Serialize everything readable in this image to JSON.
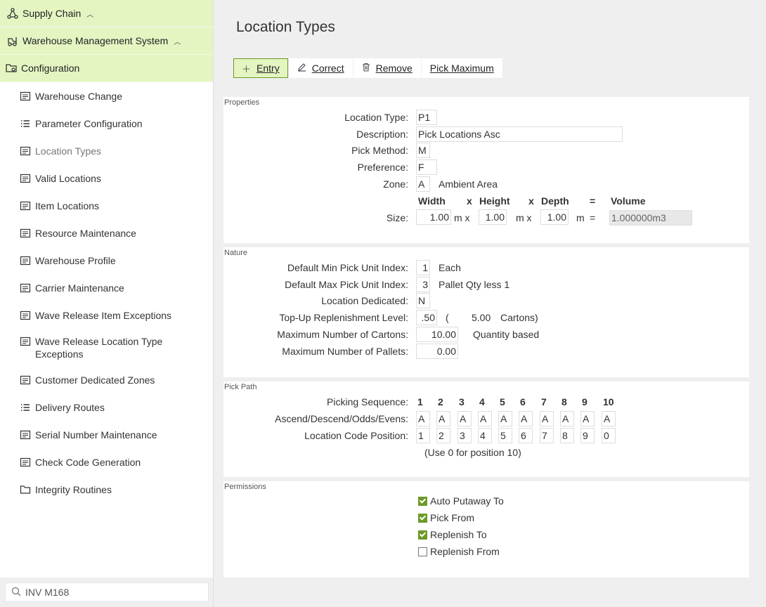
{
  "sidebar": {
    "top": [
      {
        "label": "Supply Chain",
        "icon": "network-icon"
      },
      {
        "label": "Warehouse Management System",
        "icon": "forklift-icon"
      },
      {
        "label": "Configuration",
        "icon": "folder-gear-icon"
      }
    ],
    "items": [
      {
        "label": "Warehouse Change",
        "icon": "form-icon"
      },
      {
        "label": "Parameter Configuration",
        "icon": "list-icon"
      },
      {
        "label": "Location Types",
        "icon": "form-icon",
        "active": true
      },
      {
        "label": "Valid Locations",
        "icon": "form-icon"
      },
      {
        "label": "Item Locations",
        "icon": "form-icon"
      },
      {
        "label": "Resource Maintenance",
        "icon": "form-icon"
      },
      {
        "label": "Warehouse Profile",
        "icon": "form-icon"
      },
      {
        "label": "Carrier Maintenance",
        "icon": "form-icon"
      },
      {
        "label": "Wave Release Item Exceptions",
        "icon": "form-icon"
      },
      {
        "label": "Wave Release Location Type Exceptions",
        "icon": "form-icon"
      },
      {
        "label": "Customer Dedicated Zones",
        "icon": "form-icon"
      },
      {
        "label": "Delivery Routes",
        "icon": "list-icon"
      },
      {
        "label": "Serial Number Maintenance",
        "icon": "form-icon"
      },
      {
        "label": "Check Code Generation",
        "icon": "form-icon"
      },
      {
        "label": "Integrity Routines",
        "icon": "folder-icon"
      }
    ],
    "search": {
      "value": "INV M168"
    }
  },
  "page": {
    "title": "Location Types"
  },
  "toolbar": {
    "entry_label": "Entry",
    "correct_label": "Correct",
    "remove_label": "Remove",
    "pick_max_label": "Pick Maximum"
  },
  "properties": {
    "title": "Properties",
    "location_type": {
      "label": "Location Type:",
      "value": "P1"
    },
    "description": {
      "label": "Description:",
      "value": "Pick Locations Asc"
    },
    "pick_method": {
      "label": "Pick Method:",
      "value": "M"
    },
    "preference": {
      "label": "Preference:",
      "value": "F"
    },
    "zone": {
      "label": "Zone:",
      "value": "A",
      "desc": "Ambient Area"
    },
    "size": {
      "label": "Size:",
      "h_width": "Width",
      "h_x1": "x",
      "h_height": "Height",
      "h_x2": "x",
      "h_depth": "Depth",
      "h_eq": "=",
      "h_volume": "Volume",
      "width": "1.00",
      "u1": "m x",
      "height": "1.00",
      "u2": "m x",
      "depth": "1.00",
      "u3": "m",
      "eq": "=",
      "volume": "1.000000m3"
    }
  },
  "nature": {
    "title": "Nature",
    "min_pick": {
      "label": "Default Min Pick Unit Index:",
      "value": "1",
      "desc": "Each"
    },
    "max_pick": {
      "label": "Default Max Pick Unit Index:",
      "value": "3",
      "desc": "Pallet Qty less 1"
    },
    "dedicated": {
      "label": "Location Dedicated:",
      "value": "N"
    },
    "topup": {
      "label": "Top-Up Replenishment Level:",
      "value": ".50",
      "paren_open": "(",
      "cartons": "5.00",
      "cartons_label": "Cartons)"
    },
    "max_cartons": {
      "label": "Maximum Number of Cartons:",
      "value": "10.00",
      "desc": "Quantity based"
    },
    "max_pallets": {
      "label": "Maximum Number of Pallets:",
      "value": "0.00"
    }
  },
  "pickpath": {
    "title": "Pick Path",
    "seq_label": "Picking Sequence:",
    "seq": [
      "1",
      "2",
      "3",
      "4",
      "5",
      "6",
      "7",
      "8",
      "9",
      "10"
    ],
    "ado_label": "Ascend/Descend/Odds/Evens:",
    "ado": [
      "A",
      "A",
      "A",
      "A",
      "A",
      "A",
      "A",
      "A",
      "A",
      "A"
    ],
    "pos_label": "Location Code Position:",
    "pos": [
      "1",
      "2",
      "3",
      "4",
      "5",
      "6",
      "7",
      "8",
      "9",
      "0"
    ],
    "note": "(Use 0 for position 10)"
  },
  "permissions": {
    "title": "Permissions",
    "items": [
      {
        "label": "Auto Putaway To",
        "checked": true
      },
      {
        "label": "Pick From",
        "checked": true
      },
      {
        "label": "Replenish To",
        "checked": true
      },
      {
        "label": "Replenish From",
        "checked": false
      }
    ]
  }
}
